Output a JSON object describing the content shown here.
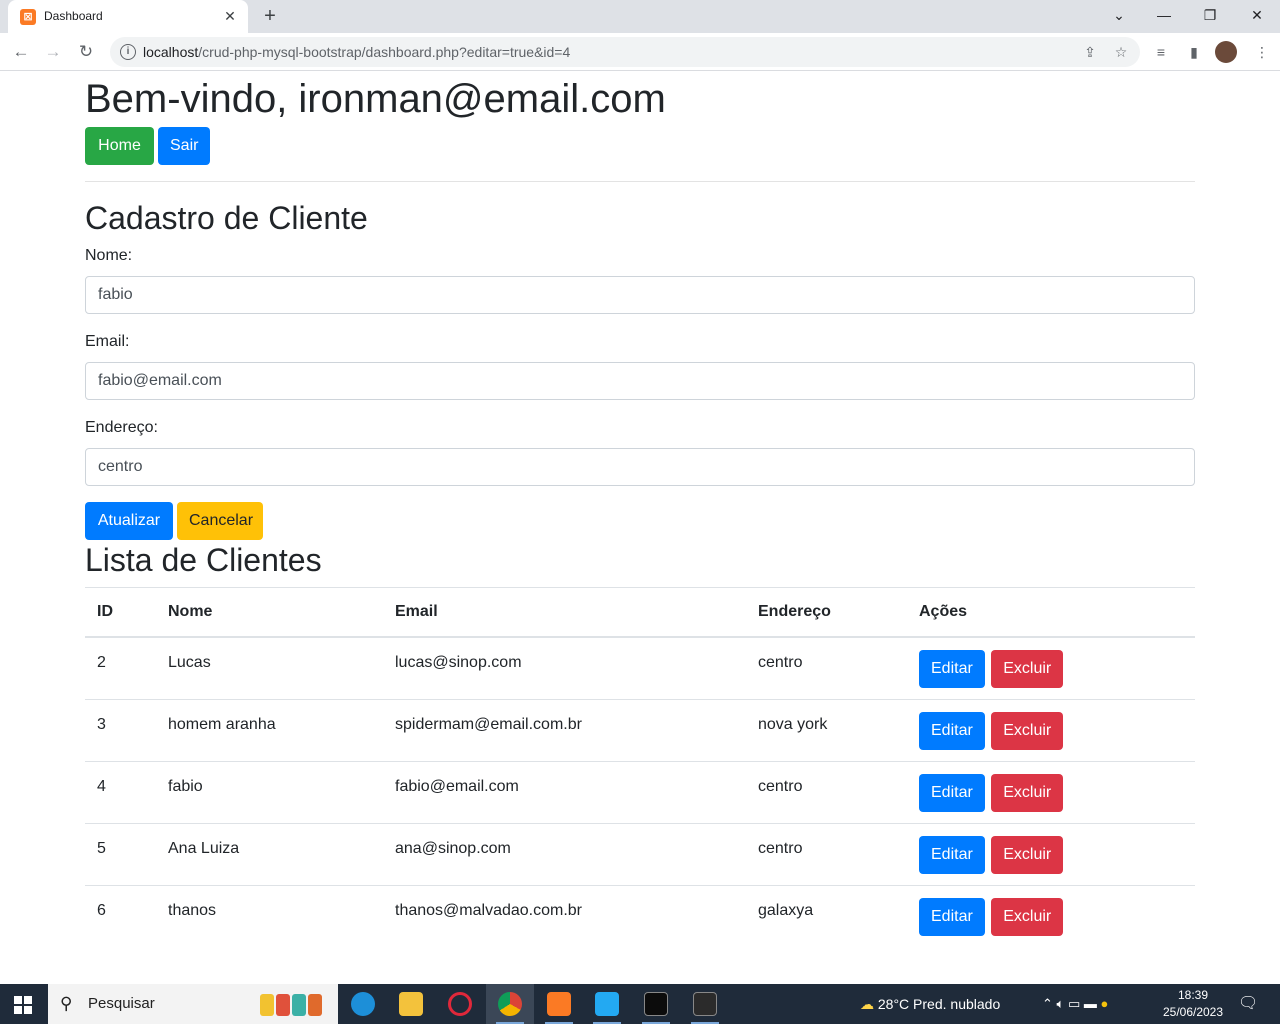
{
  "browser": {
    "tab_title": "Dashboard",
    "url_host": "localhost",
    "url_path": "/crud-php-mysql-bootstrap/dashboard.php?editar=true&id=4"
  },
  "header": {
    "welcome": "Bem-vindo, ironman@email.com",
    "home_label": "Home",
    "logout_label": "Sair"
  },
  "form": {
    "title": "Cadastro de Cliente",
    "name_label": "Nome:",
    "name_value": "fabio",
    "email_label": "Email:",
    "email_value": "fabio@email.com",
    "address_label": "Endereço:",
    "address_value": "centro",
    "update_label": "Atualizar",
    "cancel_label": "Cancelar"
  },
  "list": {
    "title": "Lista de Clientes",
    "columns": [
      "ID",
      "Nome",
      "Email",
      "Endereço",
      "Ações"
    ],
    "edit_label": "Editar",
    "delete_label": "Excluir",
    "rows": [
      {
        "id": "2",
        "name": "Lucas",
        "email": "lucas@sinop.com",
        "address": "centro"
      },
      {
        "id": "3",
        "name": "homem aranha",
        "email": "spidermam@email.com.br",
        "address": "nova york"
      },
      {
        "id": "4",
        "name": "fabio",
        "email": "fabio@email.com",
        "address": "centro"
      },
      {
        "id": "5",
        "name": "Ana Luiza",
        "email": "ana@sinop.com",
        "address": "centro"
      },
      {
        "id": "6",
        "name": "thanos",
        "email": "thanos@malvadao.com.br",
        "address": "galaxya"
      }
    ]
  },
  "taskbar": {
    "search_placeholder": "Pesquisar",
    "weather": "28°C  Pred. nublado",
    "time": "18:39",
    "date": "25/06/2023"
  },
  "colors": {
    "success": "#28a745",
    "primary": "#007bff",
    "warning": "#ffc107",
    "danger": "#dc3545"
  }
}
